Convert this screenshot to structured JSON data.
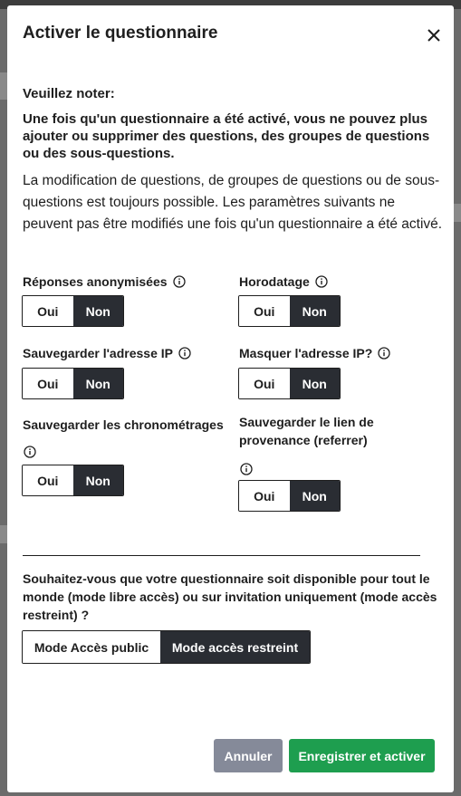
{
  "dialog": {
    "title": "Activer le questionnaire",
    "close_icon": "close-icon"
  },
  "notice": {
    "heading": "Veuillez noter:",
    "warning": "Une fois qu'un questionnaire a été activé, vous ne pouvez plus ajouter ou supprimer des questions, des groupes de questions ou des sous-questions.",
    "body": "La modification de questions, de groupes de questions ou de sous-questions est toujours possible. Les paramètres suivants ne peuvent pas être modifiés une fois qu'un questionnaire a été activé."
  },
  "options": [
    {
      "label": "Réponses anonymisées",
      "yes": "Oui",
      "no": "Non",
      "selected": "Non"
    },
    {
      "label": "Horodatage",
      "yes": "Oui",
      "no": "Non",
      "selected": "Non"
    },
    {
      "label": "Sauvegarder l'adresse IP",
      "yes": "Oui",
      "no": "Non",
      "selected": "Non"
    },
    {
      "label": "Masquer l'adresse IP?",
      "yes": "Oui",
      "no": "Non",
      "selected": "Non"
    },
    {
      "label": "Sauvegarder les chronométrages",
      "yes": "Oui",
      "no": "Non",
      "selected": "Non"
    },
    {
      "label": "Sauvegarder le lien de provenance (referrer)",
      "yes": "Oui",
      "no": "Non",
      "selected": "Non"
    }
  ],
  "access": {
    "question": "Souhaitez-vous que votre questionnaire soit disponible pour tout le monde (mode libre accès) ou sur invitation uniquement (mode accès restreint) ?",
    "public_label": "Mode Accès public",
    "restricted_label": "Mode accès restreint",
    "selected": "Mode accès restreint"
  },
  "footer": {
    "cancel_label": "Annuler",
    "save_label": "Enregistrer et activer"
  },
  "colors": {
    "accent_green": "#1e9e4f",
    "cancel_gray": "#858a99",
    "selected_dark": "#2a2d33"
  }
}
